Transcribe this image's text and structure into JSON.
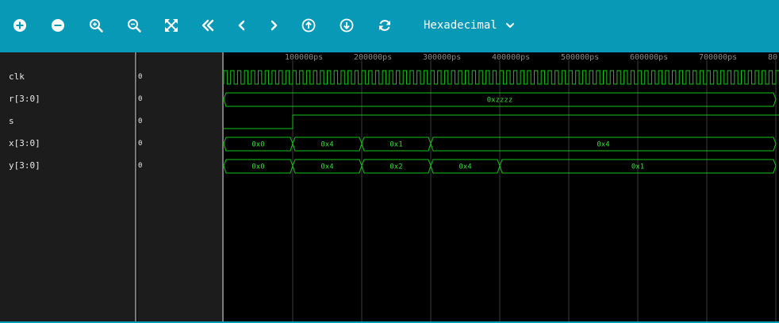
{
  "toolbar": {
    "buttons": [
      {
        "name": "zoom-in-all-button",
        "icon": "plus-circle-icon"
      },
      {
        "name": "zoom-out-all-button",
        "icon": "minus-circle-icon"
      },
      {
        "name": "zoom-in-button",
        "icon": "magnify-plus-icon"
      },
      {
        "name": "zoom-out-button",
        "icon": "magnify-minus-icon"
      },
      {
        "name": "fit-to-window-button",
        "icon": "expand-arrows-icon"
      },
      {
        "name": "go-to-start-button",
        "icon": "double-chevron-left-icon"
      },
      {
        "name": "previous-edge-button",
        "icon": "chevron-left-icon"
      },
      {
        "name": "next-edge-button",
        "icon": "chevron-right-icon"
      },
      {
        "name": "move-signal-up-button",
        "icon": "arrow-up-circle-icon"
      },
      {
        "name": "move-signal-down-button",
        "icon": "arrow-down-circle-icon"
      },
      {
        "name": "refresh-button",
        "icon": "refresh-icon"
      }
    ],
    "radix_label": "Hexadecimal"
  },
  "colors": {
    "toolbar": "#0799b5",
    "panel": "#1c1c1c",
    "wave": "#19c419",
    "wave_text": "#35e035",
    "grid": "#3c3c3c",
    "tick_label": "#8a8a8a"
  },
  "signals": [
    {
      "name": "clk",
      "value": "0"
    },
    {
      "name": "r[3:0]",
      "value": "0"
    },
    {
      "name": "s",
      "value": "0"
    },
    {
      "name": "x[3:0]",
      "value": "0"
    },
    {
      "name": "y[3:0]",
      "value": "0"
    }
  ],
  "timeline": {
    "ticks": [
      "100000ps",
      "200000ps",
      "300000ps",
      "400000ps",
      "500000ps",
      "600000ps",
      "700000ps",
      "80"
    ]
  },
  "waves": {
    "clk": {
      "half_period_ps": 5000
    },
    "r": [
      {
        "start": 0,
        "end": 800000,
        "label": "0xzzzz"
      }
    ],
    "s": [
      {
        "t": 0,
        "v": 0
      },
      {
        "t": 100000,
        "v": 1
      }
    ],
    "x": [
      {
        "start": 0,
        "end": 100000,
        "label": "0x0"
      },
      {
        "start": 100000,
        "end": 200000,
        "label": "0x4"
      },
      {
        "start": 200000,
        "end": 300000,
        "label": "0x1"
      },
      {
        "start": 300000,
        "end": 800000,
        "label": "0x4"
      }
    ],
    "y": [
      {
        "start": 0,
        "end": 100000,
        "label": "0x0"
      },
      {
        "start": 100000,
        "end": 200000,
        "label": "0x4"
      },
      {
        "start": 200000,
        "end": 300000,
        "label": "0x2"
      },
      {
        "start": 300000,
        "end": 400000,
        "label": "0x4"
      },
      {
        "start": 400000,
        "end": 800000,
        "label": "0x1"
      }
    ]
  }
}
